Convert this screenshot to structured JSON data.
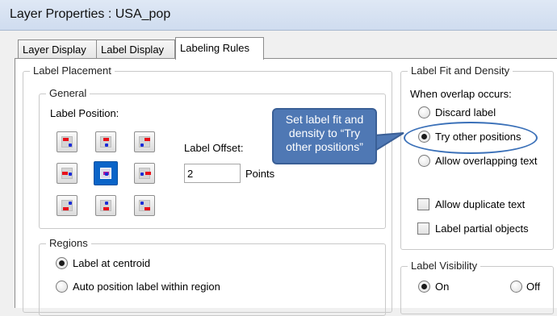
{
  "window": {
    "title": "Layer Properties  : USA_pop"
  },
  "tabs": [
    {
      "label": "Layer Display"
    },
    {
      "label": "Label Display"
    },
    {
      "label": "Labeling Rules"
    }
  ],
  "label_placement": {
    "legend": "Label Placement",
    "general_legend": "General",
    "label_position_label": "Label Position:",
    "selected_position": "center",
    "label_offset_label": "Label Offset:",
    "label_offset_value": "2",
    "offset_unit": "Points"
  },
  "regions": {
    "legend": "Regions",
    "options": [
      {
        "label": "Label at centroid",
        "checked": true
      },
      {
        "label": "Auto position label within region",
        "checked": false
      }
    ]
  },
  "fit_density": {
    "legend": "Label Fit and Density",
    "overlap_heading": "When overlap occurs:",
    "options": [
      {
        "label": "Discard label",
        "checked": false
      },
      {
        "label": "Try other positions",
        "checked": true
      },
      {
        "label": "Allow overlapping text",
        "checked": false
      }
    ],
    "checkboxes": [
      {
        "label": "Allow duplicate text",
        "checked": false
      },
      {
        "label": "Label partial objects",
        "checked": false
      }
    ]
  },
  "visibility": {
    "legend": "Label Visibility",
    "on_label": "On",
    "off_label": "Off",
    "selected": "On"
  },
  "callout": {
    "line1": "Set label fit and",
    "line2": "density to “Try",
    "line3": "other positions”",
    "fill_color": "#4f78b4",
    "highlight_color": "#3a70b8"
  }
}
